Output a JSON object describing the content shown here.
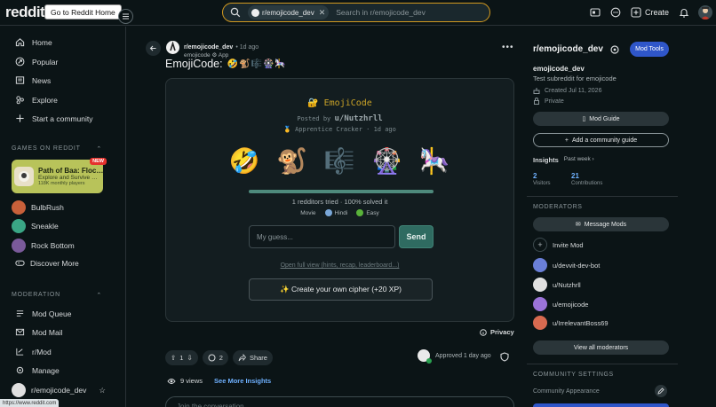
{
  "topbar": {
    "logo_text": "reddit",
    "tooltip": "Go to Reddit Home",
    "search_chip": "r/emojicode_dev",
    "search_placeholder": "Search in r/emojicode_dev",
    "create_label": "Create"
  },
  "leftnav": {
    "items": [
      {
        "label": "Home",
        "icon": "home-icon"
      },
      {
        "label": "Popular",
        "icon": "popular-icon"
      },
      {
        "label": "News",
        "icon": "news-icon"
      },
      {
        "label": "Explore",
        "icon": "explore-icon"
      },
      {
        "label": "Start a community",
        "icon": "plus-icon"
      }
    ],
    "games_heading": "GAMES ON REDDIT",
    "featured_game": {
      "title": "Path of Baa: Floc…",
      "subtitle": "Explore and Survive …",
      "players": "118K monthly players",
      "badge": "NEW"
    },
    "games": [
      {
        "label": "BulbRush",
        "color": "#c8603a"
      },
      {
        "label": "Sneakle",
        "color": "#3aa685"
      },
      {
        "label": "Rock Bottom",
        "color": "#7a5a9a"
      },
      {
        "label": "Discover More",
        "color": ""
      }
    ],
    "moderation_heading": "MODERATION",
    "moderation": [
      {
        "label": "Mod Queue"
      },
      {
        "label": "Mod Mail"
      },
      {
        "label": "r/Mod"
      },
      {
        "label": "Manage"
      },
      {
        "label": "r/emojicode_dev"
      }
    ],
    "status_url": "https://www.reddit.com"
  },
  "post": {
    "subreddit": "r/emojicode_dev",
    "time": "• 1d ago",
    "author": "emojicode",
    "author_tag": "App",
    "title": "EmojiCode:",
    "title_emojis": "🤣🐒🎼🎡🎠",
    "card": {
      "brand": "🔐 EmojiCode",
      "posted_by_prefix": "Posted by",
      "posted_by_user": "u/Nutzhrll",
      "rank": "🥇 Apprentice Cracker · 1d ago",
      "emojis": [
        "🤣",
        "🐒",
        "🎼",
        "🎡",
        "🎠"
      ],
      "progress": 1.0,
      "tried_text": "1 redditors tried · 100% solved it",
      "tags": [
        {
          "label": "Movie",
          "dot": ""
        },
        {
          "label": "Hindi",
          "dot": "#7aa7d8"
        },
        {
          "label": "Easy",
          "dot": "#59b23a"
        }
      ],
      "guess_placeholder": "My guess...",
      "send_label": "Send",
      "full_view_link": "Open full view (hints, recap, leaderboard...)",
      "create_cipher": "✨ Create your own cipher (+20 XP)"
    },
    "privacy": "Privacy",
    "votes": "1",
    "comments": "2",
    "share": "Share",
    "approved": "Approved 1 day ago",
    "views": "9 views",
    "see_insights": "See More Insights",
    "comment_placeholder": "Join the conversation"
  },
  "sidebar": {
    "title": "r/emojicode_dev",
    "mod_tools": "Mod Tools",
    "name": "emojicode_dev",
    "description": "Test subreddit for emojicode",
    "created": "Created Jul 11, 2026",
    "visibility": "Private",
    "mod_guide": "Mod Guide",
    "add_guide": "Add a community guide",
    "insights_label": "Insights",
    "insights_period": "Past week ›",
    "visitors_num": "2",
    "visitors_label": "Visitors",
    "contrib_num": "21",
    "contrib_label": "Contributions",
    "moderators_heading": "MODERATORS",
    "message_mods": "Message Mods",
    "invite_mod": "Invite Mod",
    "mods": [
      {
        "name": "u/devvit-dev-bot",
        "color": "#6a7fd8"
      },
      {
        "name": "u/Nutzhrll",
        "color": "#e0e0e0"
      },
      {
        "name": "u/emojicode",
        "color": "#9b73d8"
      },
      {
        "name": "u/IrrelevantBoss69",
        "color": "#d86a50"
      }
    ],
    "view_all_mods": "View all moderators",
    "settings_heading": "COMMUNITY SETTINGS",
    "appearance": "Community Appearance"
  }
}
